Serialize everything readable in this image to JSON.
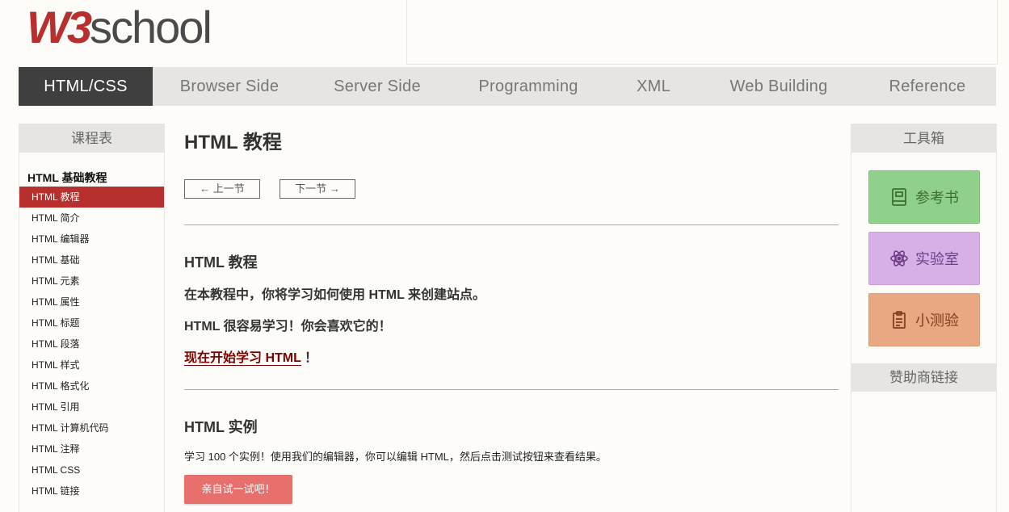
{
  "logo": {
    "w3": "W3",
    "school": "school"
  },
  "nav": [
    "HTML/CSS",
    "Browser Side",
    "Server Side",
    "Programming",
    "XML",
    "Web Building",
    "Reference"
  ],
  "left": {
    "title": "课程表",
    "section": "HTML 基础教程",
    "items": [
      "HTML 教程",
      "HTML 简介",
      "HTML 编辑器",
      "HTML 基础",
      "HTML 元素",
      "HTML 属性",
      "HTML 标题",
      "HTML 段落",
      "HTML 样式",
      "HTML 格式化",
      "HTML 引用",
      "HTML 计算机代码",
      "HTML 注释",
      "HTML CSS",
      "HTML 链接"
    ]
  },
  "main": {
    "title": "HTML 教程",
    "prev": "上一节",
    "next": "下一节",
    "section1_title": "HTML 教程",
    "para1": "在本教程中，你将学习如何使用 HTML 来创建站点。",
    "para2": "HTML 很容易学习！你会喜欢它的！",
    "link_text": "现在开始学习 HTML",
    "link_after": "！",
    "section2_title": "HTML 实例",
    "para3": "学习 100 个实例！使用我们的编辑器，你可以编辑 HTML，然后点击测试按钮来查看结果。",
    "try_button": "亲自试一试吧！"
  },
  "right": {
    "title": "工具箱",
    "tools": [
      {
        "label": "参考书",
        "icon": "book-icon"
      },
      {
        "label": "实验室",
        "icon": "atom-icon"
      },
      {
        "label": "小测验",
        "icon": "clipboard-icon"
      }
    ],
    "sponsor": "赞助商链接"
  },
  "colors": {
    "accent": "#b7302d",
    "nav_active": "#3f3f3f",
    "tool_green": "#8fd18a",
    "tool_purple": "#d7b1e6",
    "tool_orange": "#e9a882",
    "try_button": "#e7706d"
  }
}
